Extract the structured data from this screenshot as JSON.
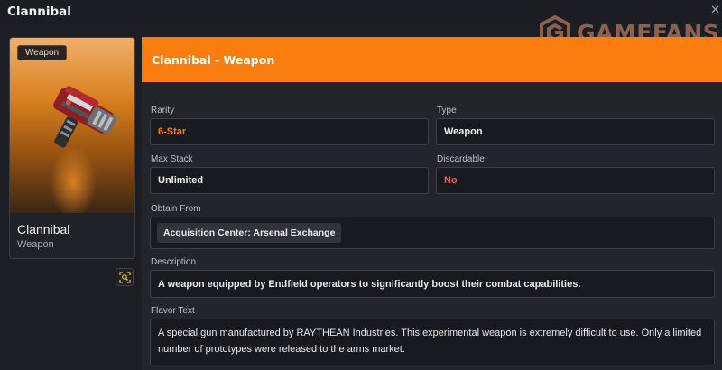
{
  "window": {
    "title": "Clannibal"
  },
  "watermark": {
    "text": "GAMEFANS"
  },
  "card": {
    "badge": "Weapon",
    "name": "Clannibal",
    "type": "Weapon"
  },
  "header": {
    "title": "Clannibal - Weapon"
  },
  "fields": {
    "rarity": {
      "label": "Rarity",
      "value": "6-Star",
      "color": "#fa7d10"
    },
    "type": {
      "label": "Type",
      "value": "Weapon"
    },
    "max_stack": {
      "label": "Max Stack",
      "value": "Unlimited"
    },
    "discardable": {
      "label": "Discardable",
      "value": "No",
      "color": "#f25c5c"
    },
    "obtain_from": {
      "label": "Obtain From",
      "items": [
        "Acquisition Center: Arsenal Exchange"
      ]
    },
    "description": {
      "label": "Description",
      "value": "A weapon equipped by Endfield operators to significantly boost their combat capabilities."
    },
    "flavor_text": {
      "label": "Flavor Text",
      "value": "A special gun manufactured by RAYTHEAN Industries. This experimental weapon is extremely difficult to use. Only a limited number of prototypes were released to the arms market."
    }
  },
  "icons": {
    "close": "close-icon",
    "zoom": "zoom-icon",
    "logo": "gamefans-logo-icon"
  },
  "colors": {
    "accent": "#fa7d10",
    "background": "#1c1e24",
    "panel": "#22252c"
  }
}
